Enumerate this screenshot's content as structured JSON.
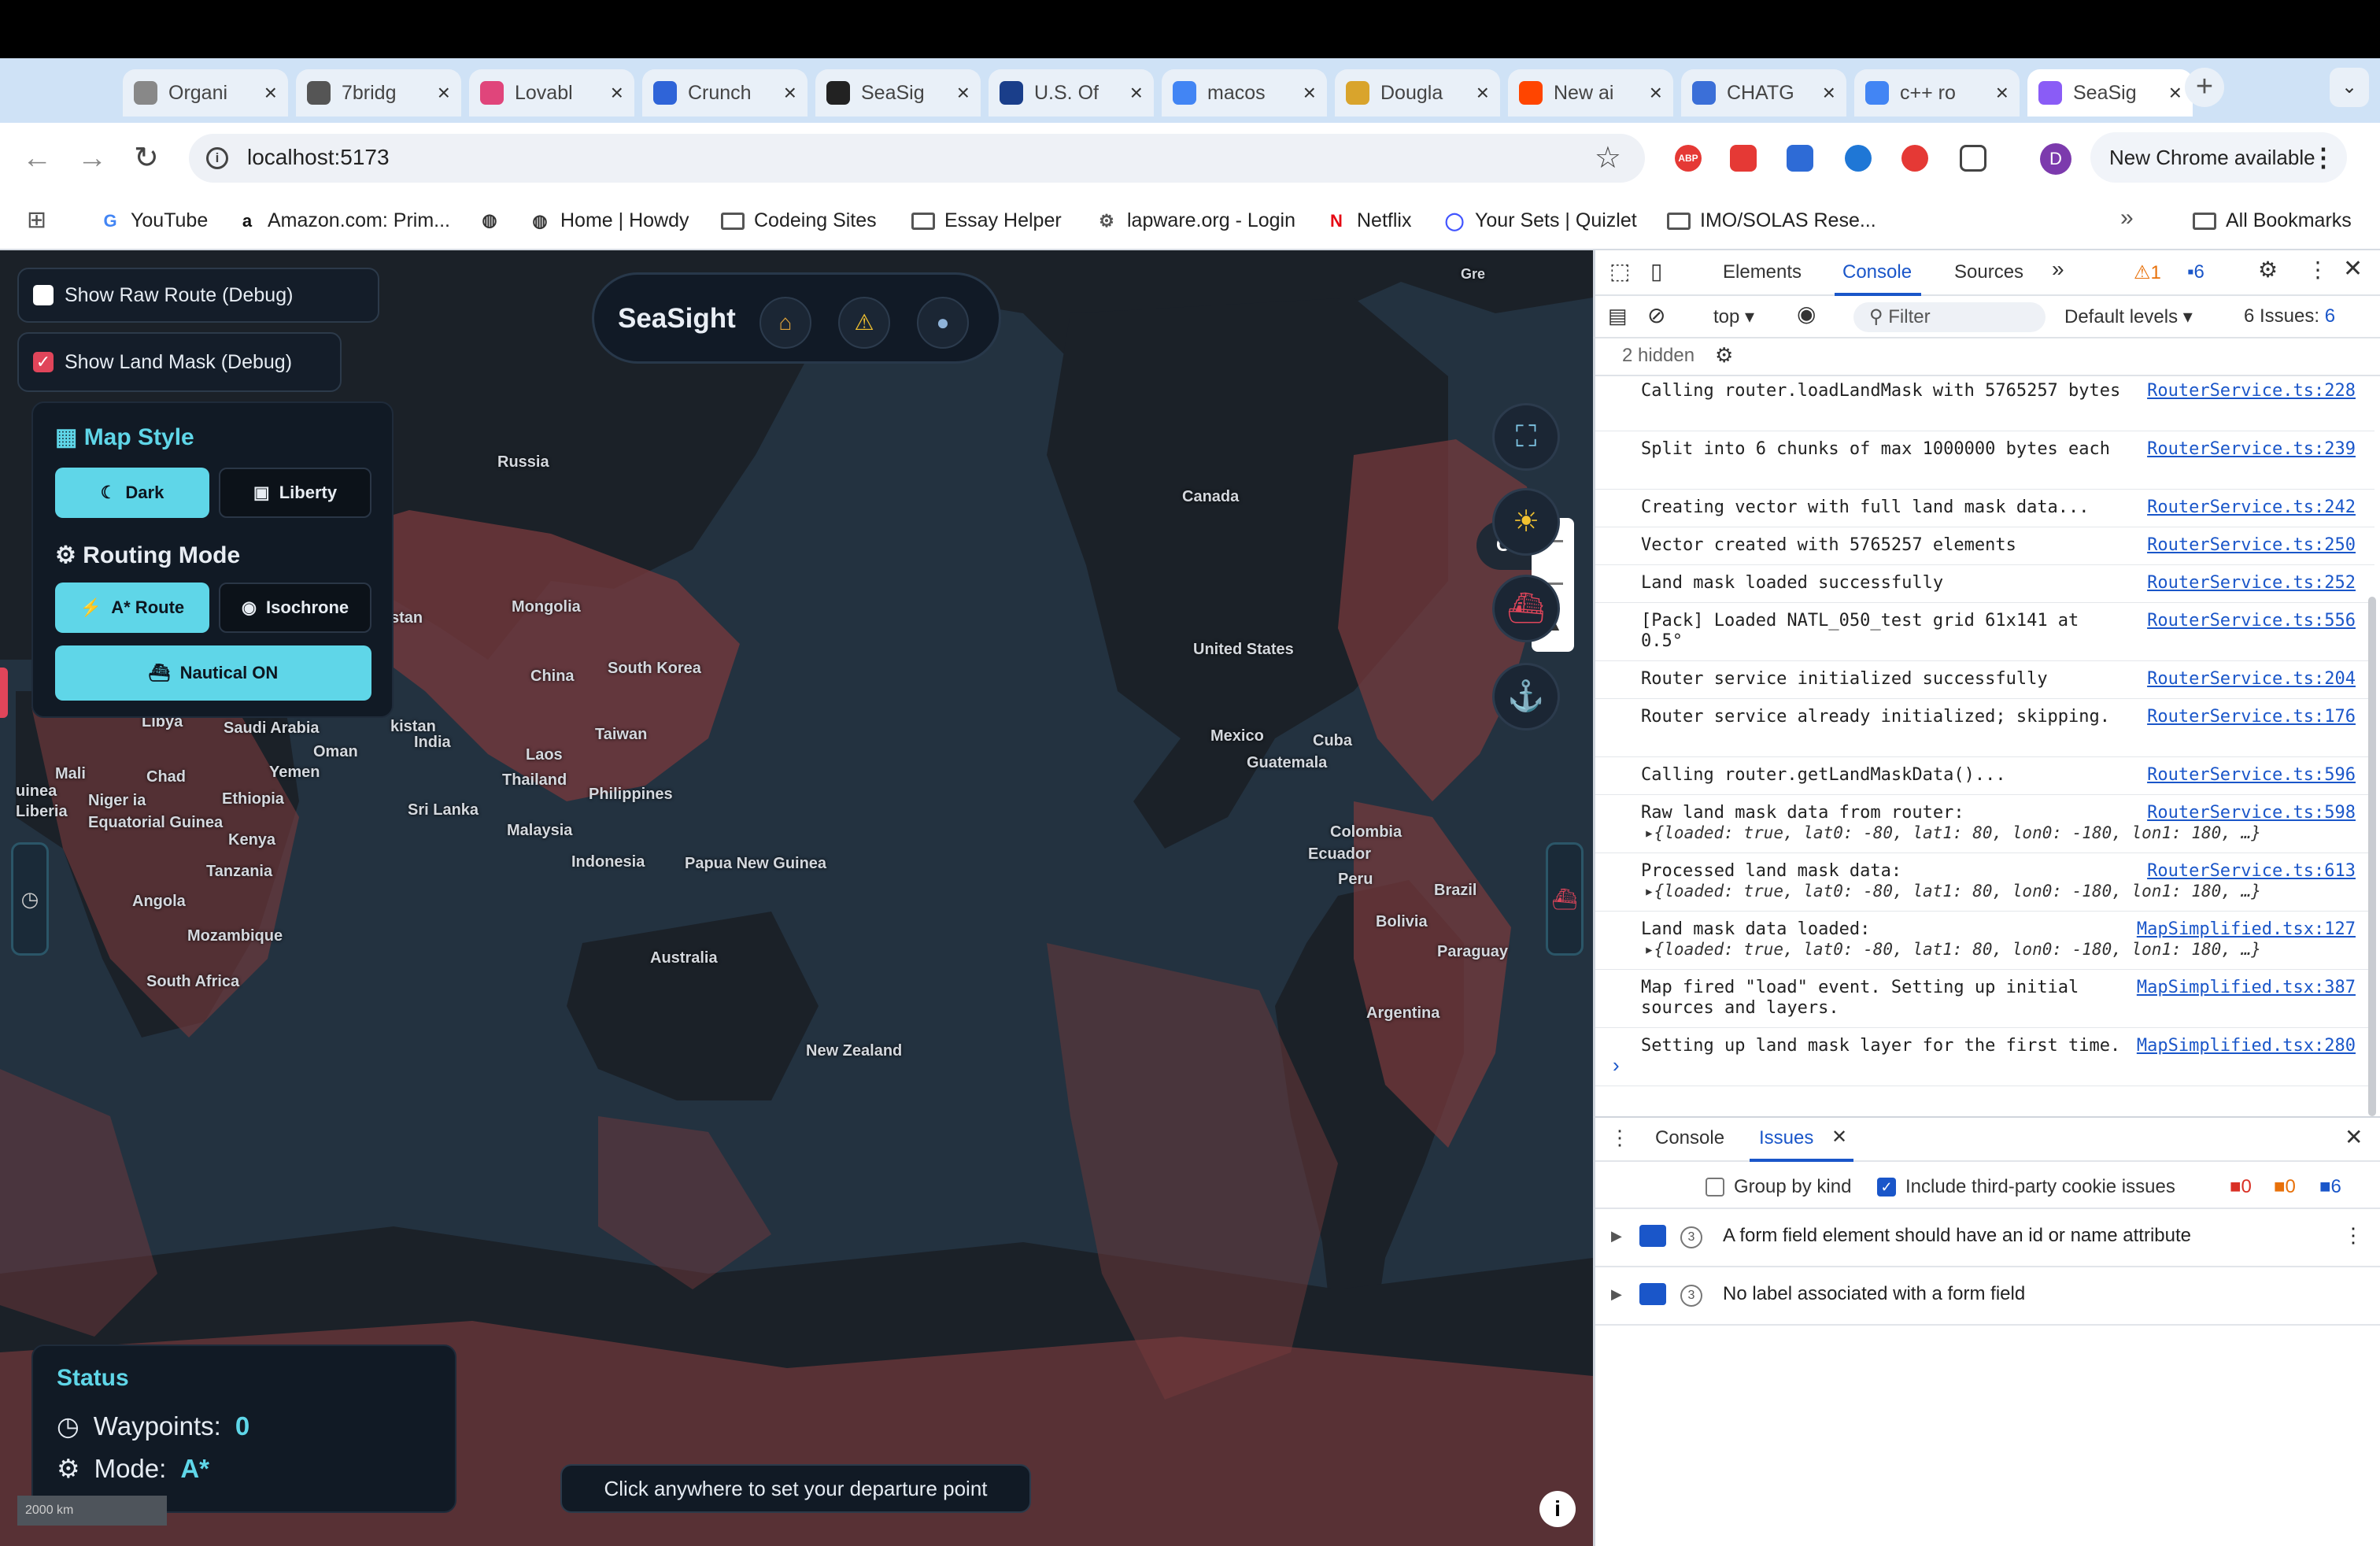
{
  "browser": {
    "tabs": [
      {
        "title": "Organi",
        "favicon": "openai-icon",
        "color": "#888888"
      },
      {
        "title": "7bridg",
        "favicon": "page-icon",
        "color": "#555555"
      },
      {
        "title": "Lovabl",
        "favicon": "lovable-icon",
        "color": "#e0457b"
      },
      {
        "title": "Crunch",
        "favicon": "crunchbase-icon",
        "color": "#2f64d8"
      },
      {
        "title": "SeaSig",
        "favicon": "github-icon",
        "color": "#222222"
      },
      {
        "title": "U.S. Of",
        "favicon": "noaa-icon",
        "color": "#1a3e8a"
      },
      {
        "title": "macos",
        "favicon": "google-icon",
        "color": "#4285f4"
      },
      {
        "title": "Dougla",
        "favicon": "map-icon",
        "color": "#d9a42c"
      },
      {
        "title": "New ai",
        "favicon": "reddit-icon",
        "color": "#ff4500"
      },
      {
        "title": "CHATG",
        "favicon": "openai-icon",
        "color": "#3b6fd8"
      },
      {
        "title": "c++ ro",
        "favicon": "google-icon",
        "color": "#4285f4"
      },
      {
        "title": "SeaSig",
        "favicon": "vite-icon",
        "color": "#8a5cf6",
        "active": true
      }
    ],
    "url": "localhost:5173",
    "update_label": "New Chrome available",
    "avatar_letter": "D",
    "bookmarks": [
      {
        "label": "YouTube",
        "icon": "google-icon"
      },
      {
        "label": "Amazon.com: Prim...",
        "icon": "amazon-icon"
      },
      {
        "label": "",
        "icon": "globe-icon"
      },
      {
        "label": "Home | Howdy",
        "icon": "globe-icon"
      },
      {
        "label": "Codeing Sites",
        "icon": "folder-icon"
      },
      {
        "label": "Essay Helper",
        "icon": "folder-icon"
      },
      {
        "label": "lapware.org - Login",
        "icon": "gear-icon"
      },
      {
        "label": "Netflix",
        "icon": "netflix-icon"
      },
      {
        "label": "Your Sets | Quizlet",
        "icon": "quizlet-icon"
      },
      {
        "label": "IMO/SOLAS Rese...",
        "icon": "folder-icon"
      }
    ],
    "all_bookmarks": "All Bookmarks"
  },
  "app": {
    "brand": "SeaSight",
    "debug": {
      "raw_route": "Show Raw Route (Debug)",
      "raw_route_checked": false,
      "land_mask": "Show Land Mask (Debug)",
      "land_mask_checked": true
    },
    "map_style": {
      "title": "Map Style",
      "dark": "Dark",
      "liberty": "Liberty",
      "selected": "Dark"
    },
    "routing": {
      "title": "Routing Mode",
      "astar": "A* Route",
      "isochrone": "Isochrone",
      "selected": "A* Route"
    },
    "nautical": "Nautical ON",
    "status": {
      "title": "Status",
      "waypoints_label": "Waypoints:",
      "waypoints": "0",
      "mode_label": "Mode:",
      "mode": "A*"
    },
    "hint": "Click anywhere to set your departure point",
    "clear": "Clear",
    "map_partial_label": "Gre",
    "scale_label": "2000 km",
    "places": [
      "Russia",
      "Canada",
      "Mongolia",
      "China",
      "South Korea",
      "United States",
      "Taiwan",
      "India",
      "Laos",
      "Thailand",
      "Philippines",
      "Sri Lanka",
      "Malaysia",
      "Indonesia",
      "Papua New Guinea",
      "Australia",
      "New Zealand",
      "Mexico",
      "Cuba",
      "Guatemala",
      "Colombia",
      "Ecuador",
      "Peru",
      "Brazil",
      "Bolivia",
      "Paraguay",
      "Argentina",
      "Libya",
      "Saudi Arabia",
      "Oman",
      "Yemen",
      "Chad",
      "Mali",
      "Niger ia",
      "Ethiopia",
      "Equatorial Guinea",
      "Kenya",
      "Tanzania",
      "Angola",
      "Mozambique",
      "South Africa",
      "uinea",
      "Liberia",
      "stan",
      "kistan"
    ]
  },
  "devtools": {
    "tabs": [
      "Elements",
      "Console",
      "Sources"
    ],
    "active_tab": "Console",
    "warnings": "1",
    "messages": "6",
    "context": "top",
    "filter_placeholder": "Filter",
    "levels": "Default levels",
    "issues_count": "6 Issues:",
    "issues_num": "6",
    "hidden": "2 hidden",
    "logs": [
      {
        "msg": "Calling router.loadLandMask with 5765257 bytes",
        "src": "RouterService.ts:228"
      },
      {
        "msg": "Split into 6 chunks of max 1000000 bytes each",
        "src": "RouterService.ts:239"
      },
      {
        "msg": "Creating vector with full land mask data...",
        "src": "RouterService.ts:242"
      },
      {
        "msg": "Vector created with 5765257 elements",
        "src": "RouterService.ts:250"
      },
      {
        "msg": "Land mask loaded successfully",
        "src": "RouterService.ts:252"
      },
      {
        "msg": "[Pack] Loaded NATL_050_test grid 61x141 at 0.5°",
        "src": "RouterService.ts:556"
      },
      {
        "msg": "Router service initialized successfully",
        "src": "RouterService.ts:204"
      },
      {
        "msg": "Router service already initialized; skipping.",
        "src": "RouterService.ts:176"
      },
      {
        "msg": "Calling router.getLandMaskData()...",
        "src": "RouterService.ts:596"
      },
      {
        "msg": "Raw land mask data from router:",
        "src": "RouterService.ts:598",
        "obj": "▸{loaded: true, lat0: -80, lat1: 80, lon0: -180, lon1: 180, …}"
      },
      {
        "msg": "Processed land mask data:",
        "src": "RouterService.ts:613",
        "obj": "▸{loaded: true, lat0: -80, lat1: 80, lon0: -180, lon1: 180, …}"
      },
      {
        "msg": "Land mask data loaded:",
        "src": "MapSimplified.tsx:127",
        "obj": "▸{loaded: true, lat0: -80, lat1: 80, lon0: -180, lon1: 180, …}"
      },
      {
        "msg": "Map fired \"load\" event. Setting up initial sources and layers.",
        "src": "MapSimplified.tsx:387"
      },
      {
        "msg": "Setting up land mask layer for the first time.",
        "src": "MapSimplified.tsx:280"
      }
    ],
    "drawer": {
      "tabs": [
        "Console",
        "Issues"
      ],
      "active": "Issues",
      "group_by_kind": "Group by kind",
      "include_third_party": "Include third-party cookie issues",
      "counts": [
        "0",
        "0",
        "6"
      ],
      "issues": [
        {
          "count": "3",
          "text": "A form field element should have an id or name attribute"
        },
        {
          "count": "3",
          "text": "No label associated with a form field"
        }
      ]
    }
  }
}
